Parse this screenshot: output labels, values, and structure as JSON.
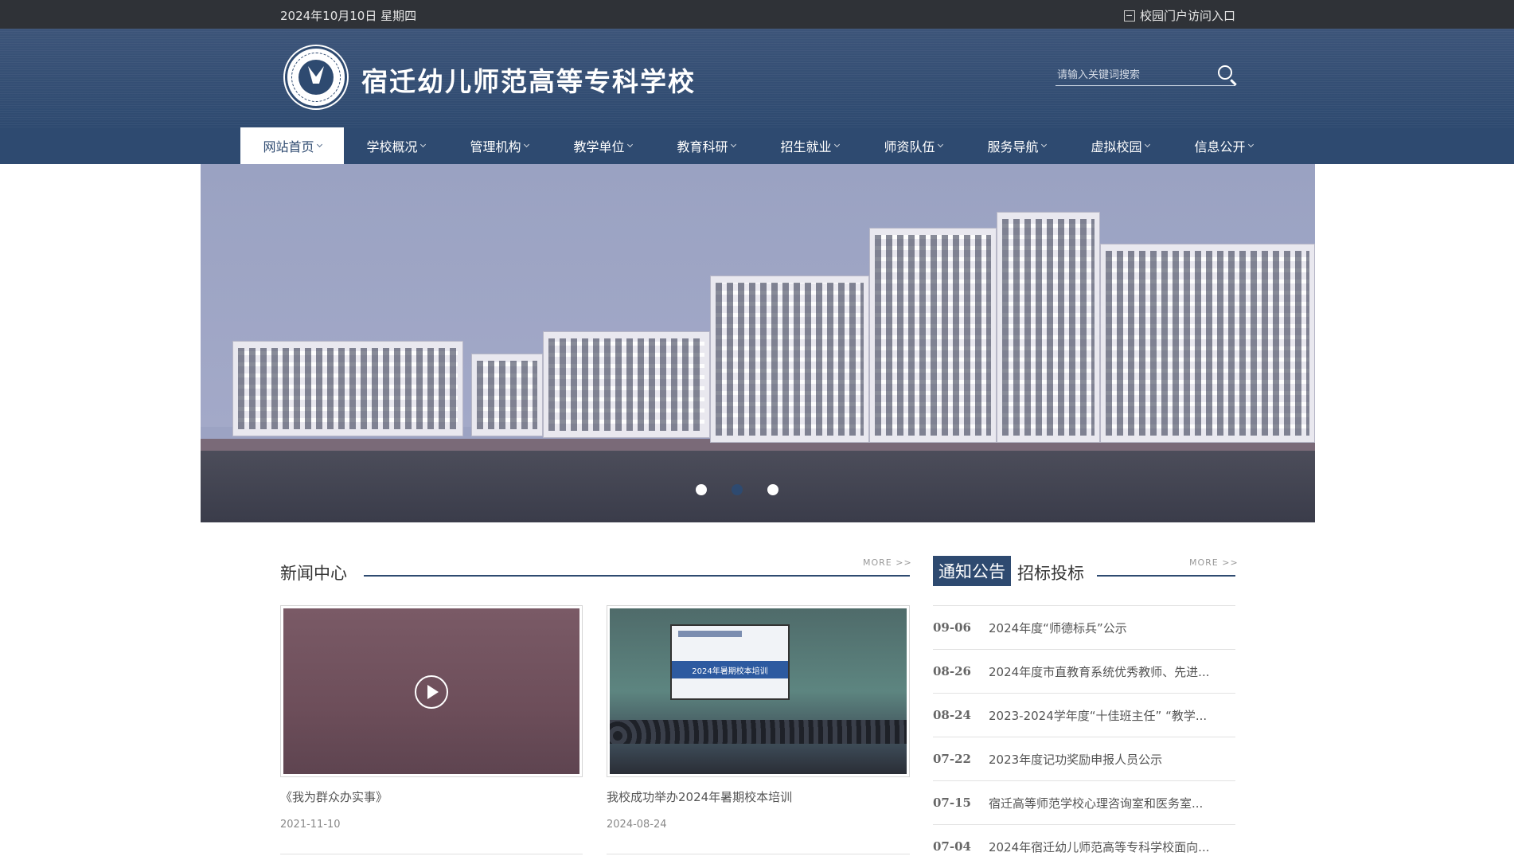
{
  "topbar": {
    "date": "2024年10月10日  星期四",
    "portal": "校园门户访问入口"
  },
  "header": {
    "site_name": "宿迁幼儿师范高等专科学校",
    "search_placeholder": "请输入关键词搜索"
  },
  "nav": [
    {
      "label": "网站首页",
      "active": true
    },
    {
      "label": "学校概况"
    },
    {
      "label": "管理机构"
    },
    {
      "label": "教学单位"
    },
    {
      "label": "教育科研"
    },
    {
      "label": "招生就业"
    },
    {
      "label": "师资队伍"
    },
    {
      "label": "服务导航"
    },
    {
      "label": "虚拟校园"
    },
    {
      "label": "信息公开"
    }
  ],
  "banner": {
    "active_dot": 2,
    "dot_count": 3
  },
  "news": {
    "title": "新闻中心",
    "more": "MORE >>",
    "items": [
      {
        "title": "《我为群众办实事》",
        "date": "2021-11-10"
      },
      {
        "title": "我校成功举办2024年暑期校本培训",
        "date": "2024-08-24",
        "screen_text": "2024年暑期校本培训"
      }
    ]
  },
  "notices": {
    "tab_active": "通知公告",
    "tab_other": "招标投标",
    "more": "MORE >>",
    "items": [
      {
        "date": "09-06",
        "title": "2024年度“师德标兵”公示"
      },
      {
        "date": "08-26",
        "title": "2024年度市直教育系统优秀教师、先进..."
      },
      {
        "date": "08-24",
        "title": "2023-2024学年度“十佳班主任” “教学..."
      },
      {
        "date": "07-22",
        "title": "2023年度记功奖励申报人员公示"
      },
      {
        "date": "07-15",
        "title": "宿迁高等师范学校心理咨询室和医务室..."
      },
      {
        "date": "07-04",
        "title": "2024年宿迁幼儿师范高等专科学校面向..."
      }
    ]
  }
}
